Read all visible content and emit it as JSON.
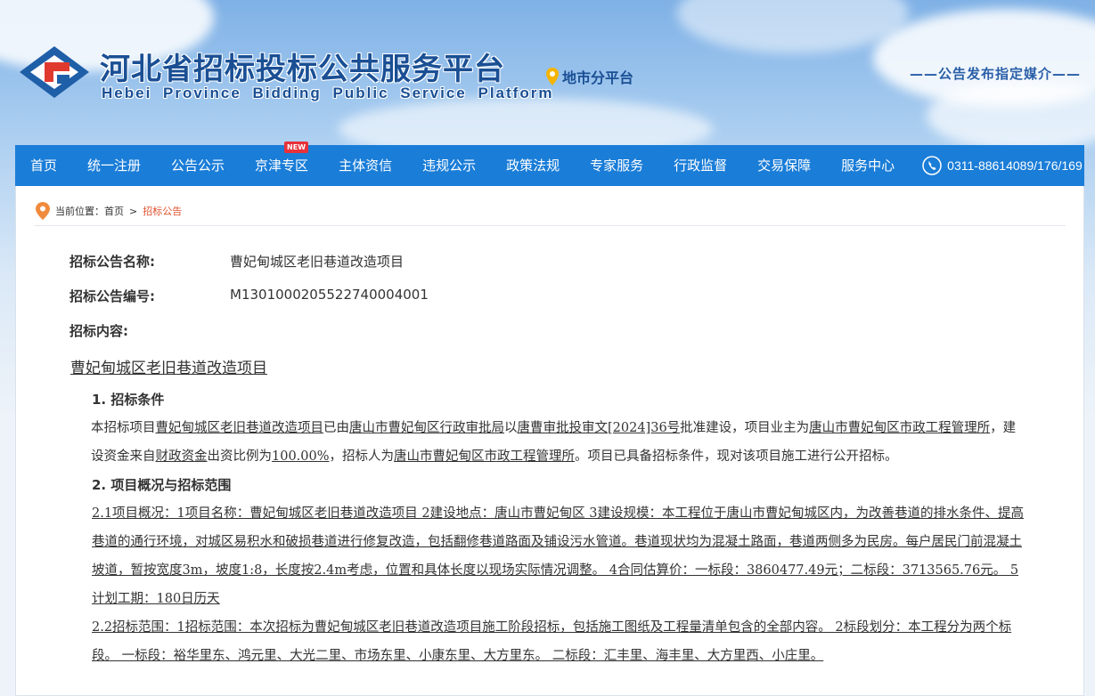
{
  "header": {
    "title_cn": "河北省招标投标公共服务平台",
    "title_en": "Hebei  Province  Bidding  Public  Service  Platform",
    "city_platform": "地市分平台",
    "slogan": "——公告发布指定媒介——"
  },
  "nav": {
    "items": [
      {
        "label": "首页"
      },
      {
        "label": "统一注册"
      },
      {
        "label": "公告公示"
      },
      {
        "label": "京津专区",
        "badge": "NEW"
      },
      {
        "label": "主体资信"
      },
      {
        "label": "违规公示"
      },
      {
        "label": "政策法规"
      },
      {
        "label": "专家服务"
      },
      {
        "label": "行政监督"
      },
      {
        "label": "交易保障"
      },
      {
        "label": "服务中心"
      }
    ],
    "phone": "0311-88614089/176/169"
  },
  "breadcrumb": {
    "prefix": "当前位置：",
    "home": "首页",
    "sep": ">",
    "current": "招标公告"
  },
  "notice": {
    "name_label": "招标公告名称:",
    "name_value": "曹妃甸城区老旧巷道改造项目",
    "code_label": "招标公告编号:",
    "code_value": "M1301000205522740004001",
    "content_label": "招标内容:",
    "doc_title": "曹妃甸城区老旧巷道改造项目",
    "sec1_title": "1. 招标条件",
    "sec1": {
      "p1": "本招标项目",
      "p2": "曹妃甸城区老旧巷道改造项目",
      "p3": "已由",
      "p4": "唐山市曹妃甸区行政审批局",
      "p5": "以",
      "p6": "唐曹审批投审文[2024]36号",
      "p7": "批准建设，项目业主为",
      "p8": "唐山市曹妃甸区市政工程管理所",
      "p9": "，建设资金来自",
      "p10": "财政资金",
      "p11": "出资比例为",
      "p12": "100.00%",
      "p13": "，招标人为",
      "p14": "唐山市曹妃甸区市政工程管理所",
      "p15": "。项目已具备招标条件，现对该项目施工进行公开招标。"
    },
    "sec2_title": "2. 项目概况与招标范围",
    "sec2_1": "2.1项目概况：1项目名称：曹妃甸城区老旧巷道改造项目 2建设地点：唐山市曹妃甸区 3建设规模：本工程位于唐山市曹妃甸城区内，为改善巷道的排水条件、提高巷道的通行环境，对城区易积水和破损巷道进行修复改造，包括翻修巷道路面及铺设污水管道。巷道现状均为混凝土路面，巷道两侧多为民房。每户居民门前混凝土坡道，暂按宽度3m，坡度1:8，长度按2.4m考虑，位置和具体长度以现场实际情况调整。 4合同估算价：一标段：3860477.49元；二标段：3713565.76元。 5计划工期：180日历天",
    "sec2_2": "2.2招标范围：1招标范围：本次招标为曹妃甸城区老旧巷道改造项目施工阶段招标，包括施工图纸及工程量清单包含的全部内容。 2标段划分：本工程分为两个标段。 一标段：裕华里东、鸿元里、大光二里、市场东里、小康东里、大方里东。 二标段：汇丰里、海丰里、大方里西、小庄里。"
  },
  "colors": {
    "nav_bg": "#1a7dd8",
    "brand_blue": "#1a4f94",
    "breadcrumb_current": "#e0522f",
    "badge_red": "#e8323a"
  }
}
